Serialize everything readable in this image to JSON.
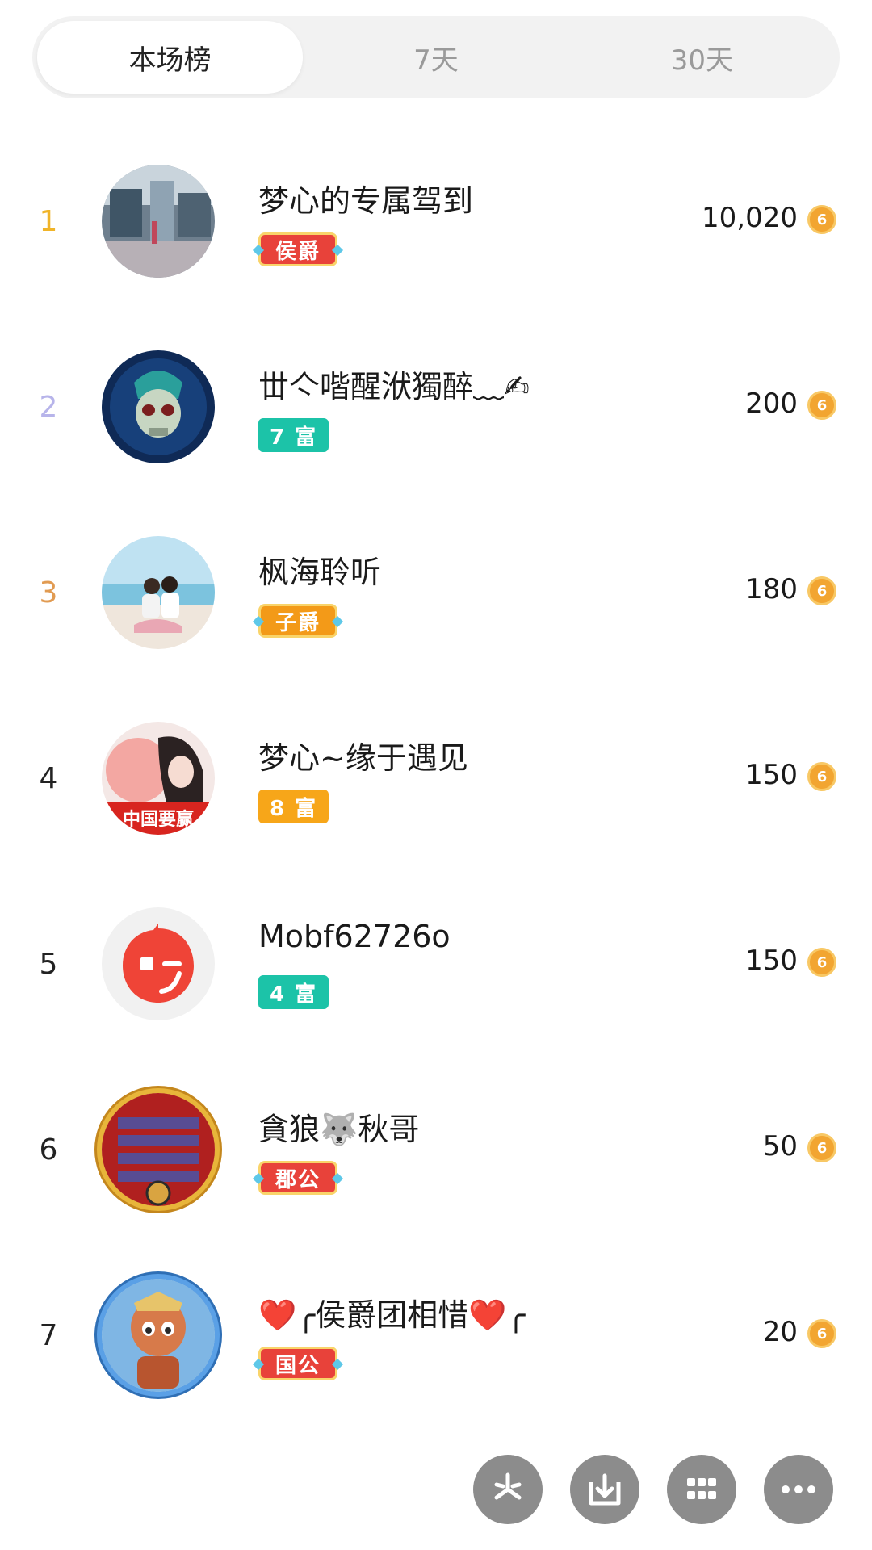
{
  "tabs": [
    {
      "label": "本场榜",
      "active": true
    },
    {
      "label": "7天",
      "active": false
    },
    {
      "label": "30天",
      "active": false
    }
  ],
  "rank_colors": {
    "1": "#f0b429",
    "2": "#b7b4ea",
    "3": "#e19b52",
    "default": "#222222"
  },
  "coin_icon": "coin-icon",
  "coin_color": "#f2a531",
  "entries": [
    {
      "rank": "1",
      "name": "梦心的专属驾到",
      "badge": "侯爵",
      "badge_style": "noble red",
      "score": "10,020",
      "avatar_icon": "mall-photo-avatar"
    },
    {
      "rank": "2",
      "name": "丗亽喈醒洑獨醉﹏✍",
      "badge": "7 富",
      "badge_style": "teal",
      "score": "200",
      "avatar_icon": "skull-avatar"
    },
    {
      "rank": "3",
      "name": "枫海聆听",
      "badge": "子爵",
      "badge_style": "noble gold",
      "score": "180",
      "avatar_icon": "beach-couple-avatar"
    },
    {
      "rank": "4",
      "name": "梦心~缘于遇见",
      "badge": "8 富",
      "badge_style": "orange",
      "score": "150",
      "avatar_icon": "woman-photo-avatar"
    },
    {
      "rank": "5",
      "name": "Mobf62726o",
      "badge": "4 富",
      "badge_style": "teal",
      "score": "150",
      "avatar_icon": "winking-face-avatar"
    },
    {
      "rank": "6",
      "name": "貪狼🐺秋哥",
      "badge": "郡公",
      "badge_style": "noble red",
      "score": "50",
      "avatar_icon": "gold-frame-avatar"
    },
    {
      "rank": "7",
      "name": "❤️╭侯爵团相惜❤️╭",
      "badge": "国公",
      "badge_style": "noble red",
      "score": "20",
      "avatar_icon": "game-character-avatar"
    }
  ],
  "avatar_text": {
    "entry4": "中国要赢"
  },
  "actions": [
    {
      "icon": "pinwheel-icon"
    },
    {
      "icon": "download-icon"
    },
    {
      "icon": "grid-icon"
    },
    {
      "icon": "more-icon"
    }
  ]
}
